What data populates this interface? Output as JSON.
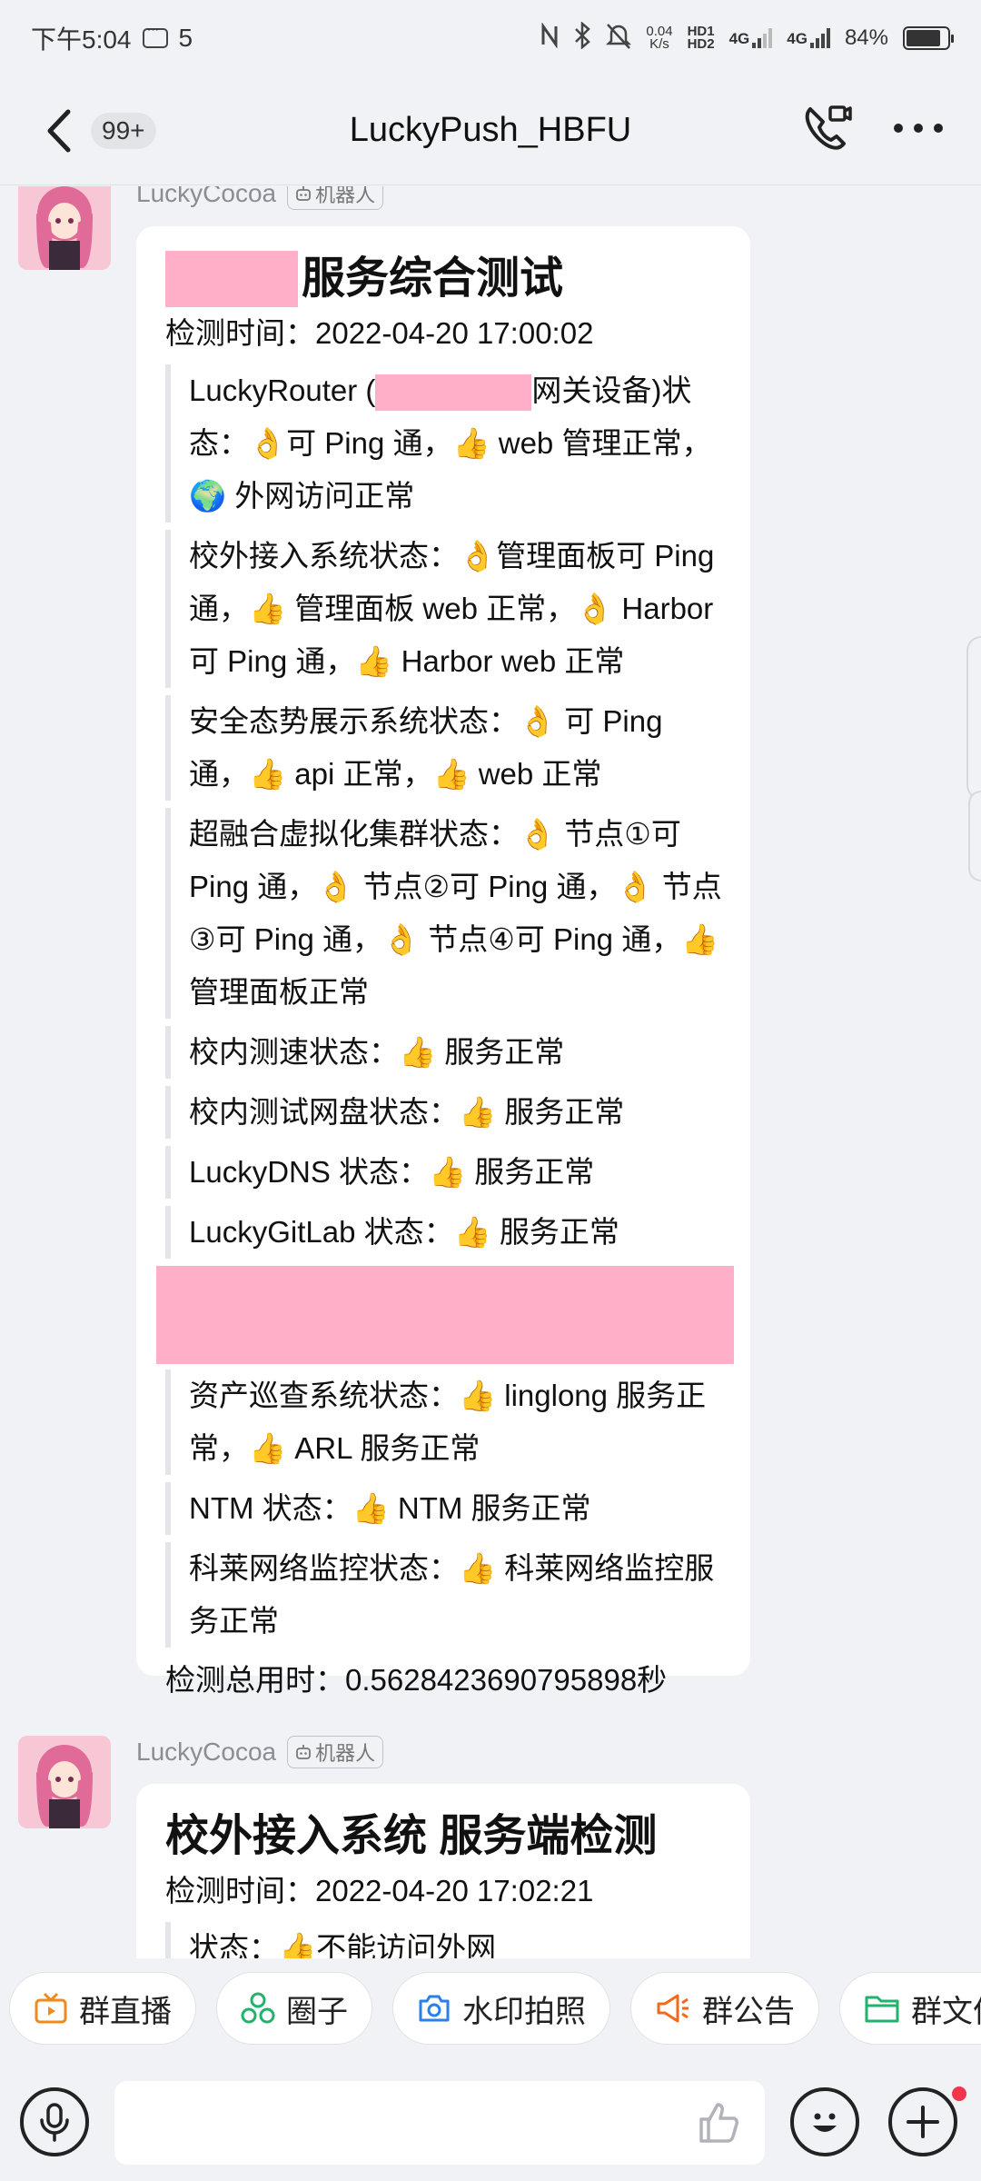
{
  "status_bar": {
    "time": "下午5:04",
    "notif_count": "5",
    "speed_value": "0.04",
    "speed_unit": "K/s",
    "hd1": "HD1",
    "hd2": "HD2",
    "net1": "4G",
    "net2": "4G",
    "battery": "84%"
  },
  "header": {
    "unread_badge": "99+",
    "title": "LuckyPush_HBFU"
  },
  "messages": [
    {
      "sender": "LuckyCocoa",
      "tag": "机器人",
      "title": "服务综合测试",
      "time_line": "检测时间：2022-04-20 17:00:02",
      "items": [
        {
          "a": "LuckyRouter (",
          "b": "网关设备)状态：",
          "c": "👌可 Ping 通，👍 web 管理正常，🌍 外网访问正常"
        },
        {
          "text": "校外接入系统状态：👌管理面板可 Ping 通，👍 管理面板 web 正常，👌 Harbor 可 Ping 通，👍 Harbor web 正常"
        },
        {
          "text": "安全态势展示系统状态：👌 可 Ping 通，👍 api 正常，👍 web 正常"
        },
        {
          "text": "超融合虚拟化集群状态：👌 节点①可 Ping 通，👌 节点②可 Ping 通，👌 节点③可 Ping 通，👌 节点④可 Ping 通，👍 管理面板正常"
        },
        {
          "text": "校内测速状态：👍 服务正常"
        },
        {
          "text": "校内测试网盘状态：👍 服务正常"
        },
        {
          "text": "LuckyDNS 状态：👍 服务正常"
        },
        {
          "text": "LuckyGitLab 状态：👍 服务正常"
        },
        {
          "text": "资产巡查系统状态：👍 linglong 服务正常，👍 ARL 服务正常"
        },
        {
          "text": "NTM 状态：👍 NTM 服务正常"
        },
        {
          "text": "科莱网络监控状态：👍 科莱网络监控服务正常"
        }
      ],
      "total_line": "检测总用时：0.5628423690795898秒"
    },
    {
      "sender": "LuckyCocoa",
      "tag": "机器人",
      "title": "校外接入系统 服务端检测",
      "time_line": "检测时间：2022-04-20 17:02:21",
      "first_item": "状态：👍不能访问外网"
    }
  ],
  "shortcuts": [
    "群直播",
    "圈子",
    "水印拍照",
    "群公告",
    "群文件"
  ],
  "colors": {
    "redaction": "#ffb0c8",
    "bubble": "#ffffff",
    "background": "#f1f2f5"
  }
}
